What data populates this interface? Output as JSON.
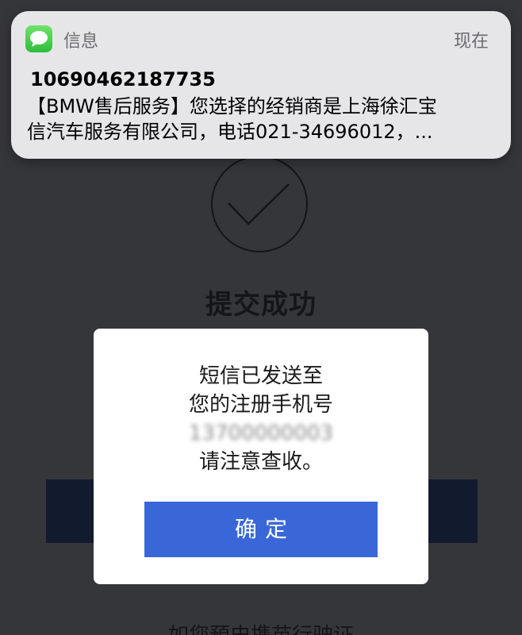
{
  "notification": {
    "app_name": "信息",
    "time": "现在",
    "sender": "10690462187735",
    "body_line1": "【BMW售后服务】您选择的经销商是上海徐汇宝",
    "body_line2": "信汽车服务有限公司，电话021-34696012，..."
  },
  "background": {
    "success_title": "提交成功",
    "bottom_text": "如您預史携苗行驶证"
  },
  "dialog": {
    "line1": "短信已发送至",
    "line2": "您的注册手机号",
    "phone_masked": "13700000003",
    "line4": "请注意查收。",
    "confirm_label": "确定"
  },
  "colors": {
    "confirm_button": "#3a67d8",
    "messages_icon": "#34c759",
    "overlay": "#333438"
  }
}
